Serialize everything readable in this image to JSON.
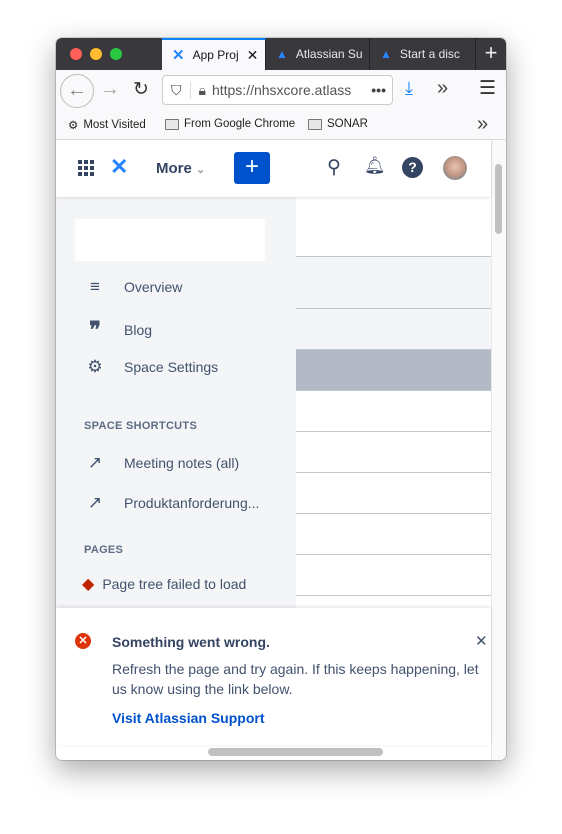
{
  "browser": {
    "tabs": [
      {
        "label": "App Proj",
        "active": true
      },
      {
        "label": "Atlassian Su",
        "active": false
      },
      {
        "label": "Start a disc",
        "active": false
      }
    ],
    "url": "https://nhsxcore.atlass",
    "bookmarks": [
      "Most Visited",
      "From Google Chrome",
      "SONAR"
    ]
  },
  "header": {
    "more_label": "More",
    "create_label": "+",
    "accent": "#0052cc"
  },
  "sidebar": {
    "items": [
      {
        "label": "Overview",
        "icon": "lines-icon"
      },
      {
        "label": "Blog",
        "icon": "quote-icon"
      },
      {
        "label": "Space Settings",
        "icon": "gear-icon"
      }
    ],
    "shortcuts_title": "SPACE SHORTCUTS",
    "shortcuts": [
      {
        "label": "Meeting notes (all)"
      },
      {
        "label": "Produktanforderung..."
      }
    ],
    "pages_title": "PAGES",
    "pages_error": "Page tree failed to load"
  },
  "flag": {
    "title": "Something went wrong.",
    "body": "Refresh the page and try again. If this keeps happening, let us know using the link below.",
    "link": "Visit Atlassian Support",
    "error_color": "#de350b"
  }
}
